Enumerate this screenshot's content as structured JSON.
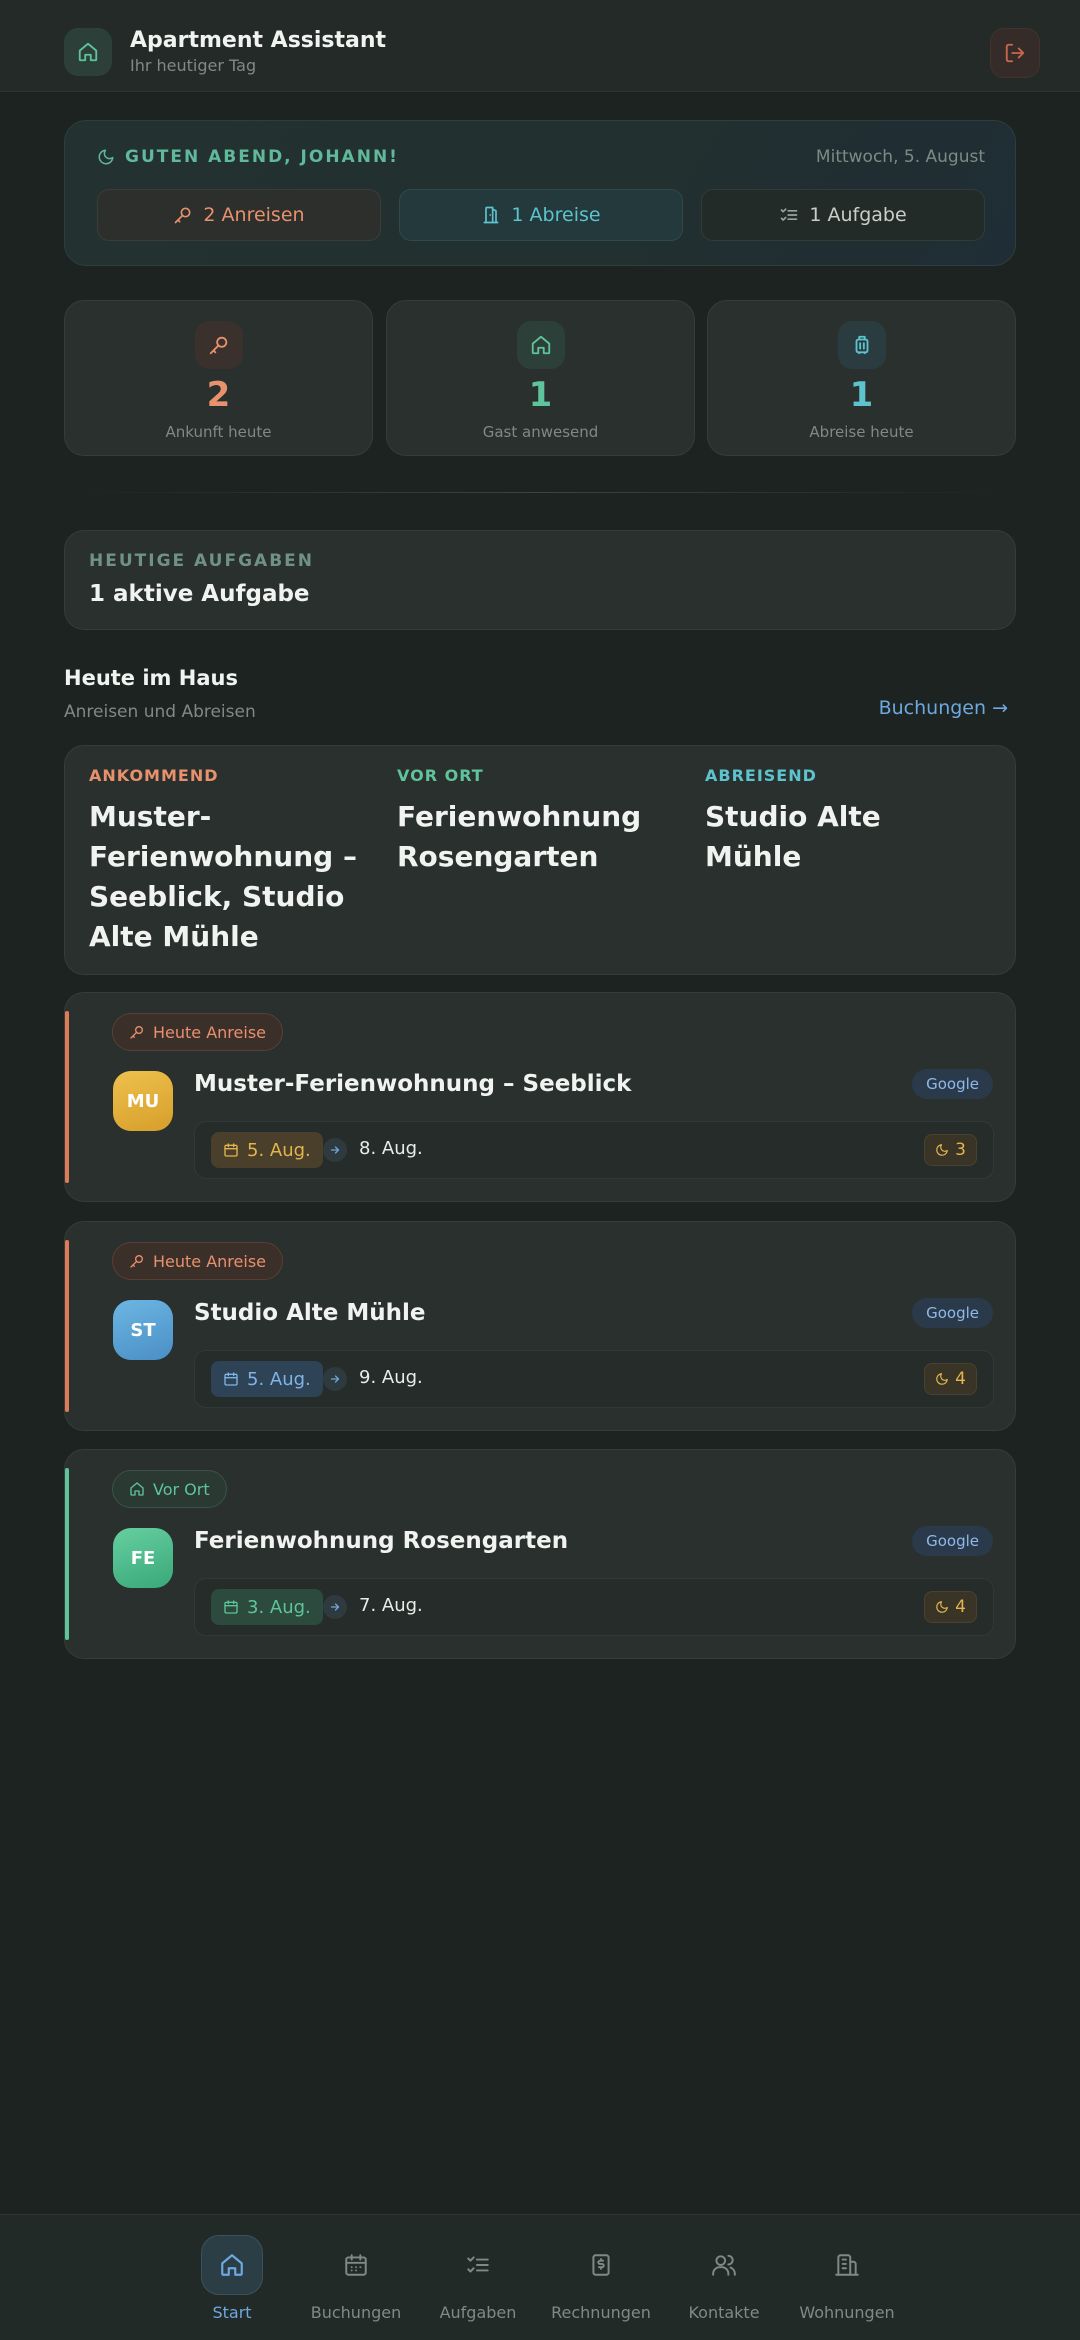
{
  "header": {
    "title": "Apartment Assistant",
    "subtitle": "Ihr heutiger Tag"
  },
  "greeting": {
    "text": "GUTEN ABEND, JOHANN!",
    "date": "Mittwoch, 5. August",
    "chips": {
      "arrivals": "2 Anreisen",
      "departures": "1 Abreise",
      "tasks": "1 Aufgabe"
    }
  },
  "stats": [
    {
      "value": "2",
      "label": "Ankunft heute",
      "color": "#e8916d"
    },
    {
      "value": "1",
      "label": "Gast anwesend",
      "color": "#5fc49c"
    },
    {
      "value": "1",
      "label": "Abreise heute",
      "color": "#5dc3cf"
    }
  ],
  "tasks": {
    "label": "HEUTIGE AUFGABEN",
    "value": "1 aktive Aufgabe"
  },
  "house": {
    "title": "Heute im Haus",
    "subtitle": "Anreisen und Abreisen",
    "link": "Buchungen →",
    "columns": [
      {
        "label": "ANKOMMEND",
        "value": "Muster-Ferienwohnung – Seeblick, Studio Alte Mühle",
        "color": "#e8916d"
      },
      {
        "label": "VOR ORT",
        "value": "Ferienwohnung Rosengarten",
        "color": "#5fc49c"
      },
      {
        "label": "ABREISEND",
        "value": "Studio Alte Mühle",
        "color": "#5dc3cf"
      }
    ]
  },
  "bookings": [
    {
      "status": "Heute Anreise",
      "status_type": "arrival",
      "initials": "MU",
      "name": "Muster-Ferienwohnung – Seeblick",
      "source": "Google",
      "start": "5. Aug.",
      "end": "8. Aug.",
      "nights": "3",
      "accent": "#e07b5a",
      "avatar_color": "#e3b23c"
    },
    {
      "status": "Heute Anreise",
      "status_type": "arrival",
      "initials": "ST",
      "name": "Studio Alte Mühle",
      "source": "Google",
      "start": "5. Aug.",
      "end": "9. Aug.",
      "nights": "4",
      "accent": "#e07b5a",
      "avatar_color": "#5aa5d6"
    },
    {
      "status": "Vor Ort",
      "status_type": "present",
      "initials": "FE",
      "name": "Ferienwohnung Rosengarten",
      "source": "Google",
      "start": "3. Aug.",
      "end": "7. Aug.",
      "nights": "4",
      "accent": "#5fc49c",
      "avatar_color": "#4fbf90"
    }
  ],
  "nav": [
    {
      "label": "Start",
      "icon": "home-icon",
      "active": true
    },
    {
      "label": "Buchungen",
      "icon": "calendar-icon"
    },
    {
      "label": "Aufgaben",
      "icon": "checklist-icon"
    },
    {
      "label": "Rechnungen",
      "icon": "invoice-icon"
    },
    {
      "label": "Kontakte",
      "icon": "contacts-icon"
    },
    {
      "label": "Wohnungen",
      "icon": "buildings-icon"
    }
  ]
}
